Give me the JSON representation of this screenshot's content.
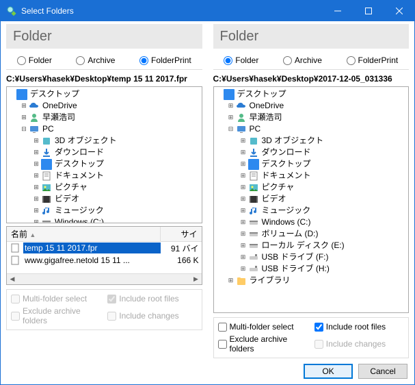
{
  "window": {
    "title": "Select Folders"
  },
  "panes": {
    "left": {
      "header": "Folder",
      "radios": {
        "folder": "Folder",
        "archive": "Archive",
        "folderprint": "FolderPrint",
        "selected": "folderprint"
      },
      "path": "C:¥Users¥hasek¥Desktop¥temp 15 11 2017.fpr",
      "tree_root": "デスクトップ",
      "tree": {
        "onedrive": "OneDrive",
        "user": "早瀬浩司",
        "pc": "PC",
        "pc_children": {
          "obj3d": "3D オブジェクト",
          "downloads": "ダウンロード",
          "desktop": "デスクトップ",
          "documents": "ドキュメント",
          "pictures": "ピクチャ",
          "videos": "ビデオ",
          "music": "ミュージック",
          "winc": "Windows (C:)"
        }
      },
      "list": {
        "col_name": "名前",
        "col_size": "サイ",
        "rows": [
          {
            "name": "temp 15 11 2017.fpr",
            "size": "91 バイ",
            "selected": true,
            "type": "file"
          },
          {
            "name": "www.gigafree.netold 15 11 ...",
            "size": "166 K",
            "selected": false,
            "type": "file"
          }
        ]
      },
      "options": {
        "multi": "Multi-folder select",
        "rootfiles": "Include root files",
        "excludearch": "Exclude archive folders",
        "changes": "Include changes",
        "rootfiles_checked": true,
        "enabled": false
      }
    },
    "right": {
      "header": "Folder",
      "radios": {
        "folder": "Folder",
        "archive": "Archive",
        "folderprint": "FolderPrint",
        "selected": "folder"
      },
      "path": "C:¥Users¥hasek¥Desktop¥2017-12-05_031336",
      "tree_root": "デスクトップ",
      "tree": {
        "onedrive": "OneDrive",
        "user": "早瀬浩司",
        "pc": "PC",
        "pc_children": {
          "obj3d": "3D オブジェクト",
          "downloads": "ダウンロード",
          "desktop": "デスクトップ",
          "documents": "ドキュメント",
          "pictures": "ピクチャ",
          "videos": "ビデオ",
          "music": "ミュージック",
          "winc": "Windows (C:)",
          "vold": "ボリューム (D:)",
          "locale": "ローカル ディスク (E:)",
          "usbf": "USB ドライブ (F:)",
          "usbh": "USB ドライブ (H:)"
        },
        "library": "ライブラリ"
      },
      "options": {
        "multi": "Multi-folder select",
        "rootfiles": "Include root files",
        "excludearch": "Exclude archive folders",
        "changes": "Include changes",
        "rootfiles_checked": true,
        "enabled": true
      }
    }
  },
  "buttons": {
    "ok": "OK",
    "cancel": "Cancel"
  }
}
